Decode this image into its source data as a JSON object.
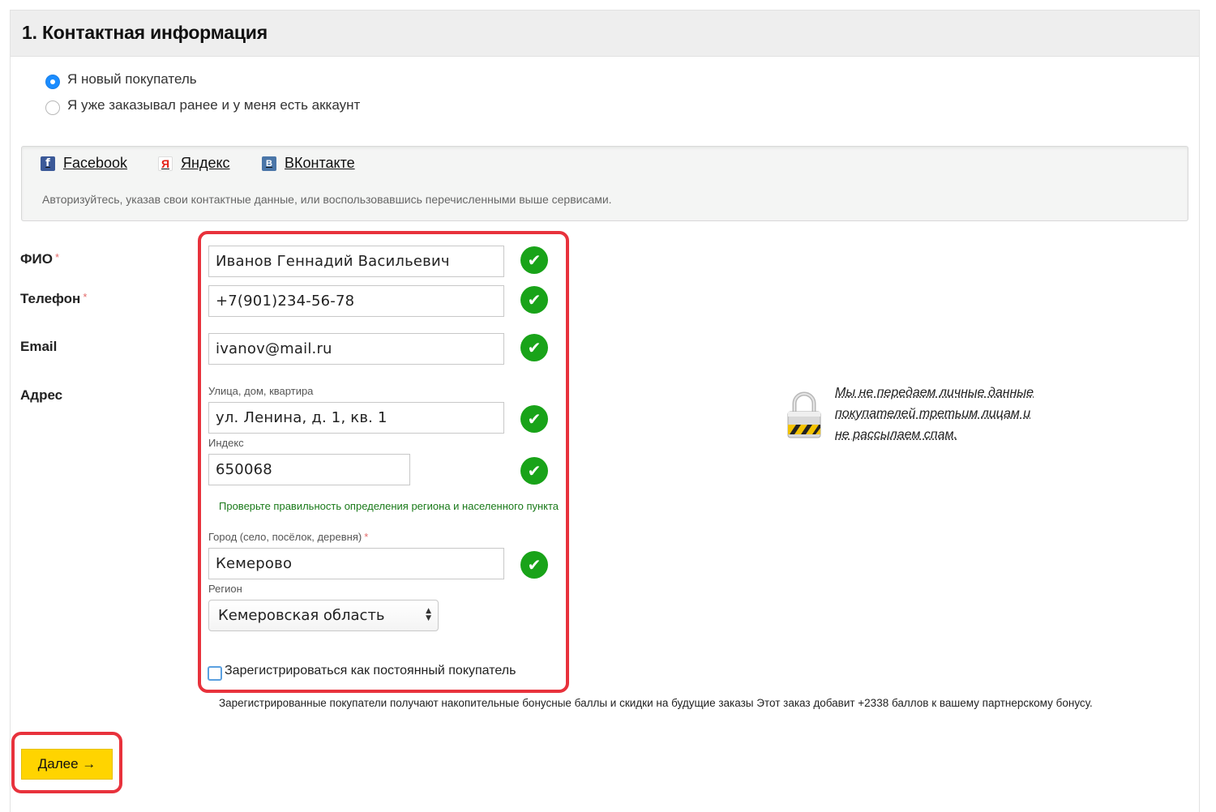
{
  "section": {
    "title": "1. Контактная информация"
  },
  "customer_type": {
    "options": [
      {
        "label": "Я новый покупатель",
        "checked": true
      },
      {
        "label": "Я уже заказывал ранее и у меня есть аккаунт",
        "checked": false
      }
    ]
  },
  "social": {
    "links": [
      {
        "label": "Facebook",
        "icon": "facebook-icon",
        "glyph": "f"
      },
      {
        "label": "Яндекс",
        "icon": "yandex-icon",
        "glyph": "Я"
      },
      {
        "label": "ВКонтакте",
        "icon": "vk-icon",
        "glyph": "В"
      }
    ],
    "note": "Авторизуйтесь, указав свои контактные данные, или воспользовавшись перечисленными выше сервисами."
  },
  "form": {
    "fio": {
      "label": "ФИО",
      "required_mark": "*",
      "value": "Иванов Геннадий Васильевич"
    },
    "phone": {
      "label": "Телефон",
      "required_mark": "*",
      "value": "+7(901)234-56-78"
    },
    "email": {
      "label": "Email",
      "value": "ivanov@mail.ru"
    },
    "address": {
      "label": "Адрес",
      "street_label": "Улица, дом, квартира",
      "street_value": "ул. Ленина, д. 1, кв. 1",
      "zip_label": "Индекс",
      "zip_value": "650068",
      "region_hint": "Проверьте правильность определения региона и населенного пункта",
      "city_label": "Город (село, посёлок, деревня)",
      "city_required_mark": "*",
      "city_value": "Кемерово",
      "region_label": "Регион",
      "region_value": "Кемеровская область"
    },
    "register_label": "Зарегистрироваться как постоянный покупатель",
    "bonus_note": "Зарегистрированные покупатели получают накопительные бонусные баллы и скидки на будущие заказы Этот заказ добавит +2338 баллов к вашему партнерскому бонусу.",
    "check_glyph": "✔"
  },
  "privacy": {
    "text": "Мы не передаем личные данные покупателей третьим лицам и не рассылаем спам."
  },
  "next_button": {
    "label": "Далее →"
  },
  "colors": {
    "accent_yellow": "#ffd400",
    "success_green": "#19a319",
    "highlight_red": "#e8323c",
    "radio_blue": "#1a8cff"
  }
}
